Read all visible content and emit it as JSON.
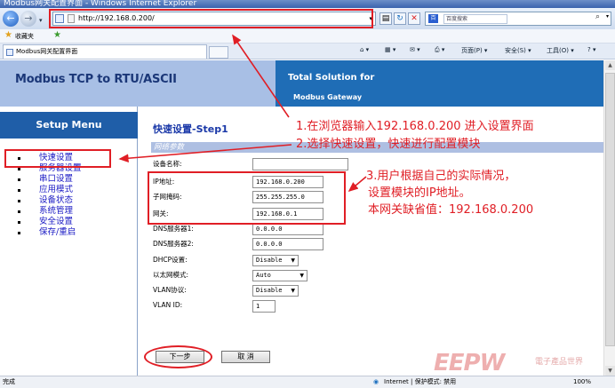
{
  "window": {
    "title": "Modbus网关配置界面 - Windows Internet Explorer"
  },
  "nav": {
    "url": "http://192.168.0.200/",
    "search_placeholder": "百度搜索",
    "search_logo": "百"
  },
  "favorites": {
    "label": "收藏夹"
  },
  "tab": {
    "title": "Modbus网关配置界面"
  },
  "commands": {
    "home": "▾",
    "feeds": "▾",
    "mail": "▾",
    "print": "▾",
    "page": "页面(P) ▾",
    "safety": "安全(S) ▾",
    "tools": "工具(O) ▾",
    "help": "▾"
  },
  "header": {
    "brand": "Modbus TCP to RTU/ASCII",
    "tagline": "Total Solution for",
    "sub": "Modbus Gateway"
  },
  "sidebar": {
    "title": "Setup Menu",
    "items": [
      "快速设置",
      "服务器设置",
      "串口设置",
      "应用模式",
      "设备状态",
      "系统管理",
      "安全设置",
      "保存/重启"
    ]
  },
  "main": {
    "step_title": "快速设置-Step1",
    "section": "网络参数",
    "fields": [
      {
        "label": "设备名称:",
        "value": ""
      },
      {
        "label": "IP地址:",
        "value": "192.168.0.200"
      },
      {
        "label": "子网掩码:",
        "value": "255.255.255.0"
      },
      {
        "label": "网关:",
        "value": "192.168.0.1"
      },
      {
        "label": "DNS服务器1:",
        "value": "0.0.0.0"
      },
      {
        "label": "DNS服务器2:",
        "value": "0.0.0.0"
      }
    ],
    "dhcp": {
      "label": "DHCP设置:",
      "value": "Disable"
    },
    "ethernet": {
      "label": "以太网模式:",
      "value": "Auto"
    },
    "vlan": {
      "label": "VLAN协议:",
      "value": "Disable"
    },
    "vlan_id": {
      "label": "VLAN ID:",
      "value": "1"
    },
    "next_button": "下一步",
    "cancel_button": "取 消"
  },
  "status": {
    "left": "完成",
    "zone": "Internet | 保护模式: 禁用",
    "zoom": "100%"
  },
  "annotations": {
    "a1": "1.在浏览器输入192.168.0.200 进入设置界面",
    "a2": "2.选择快速设置，快速进行配置模块",
    "a3_line1": "3.用户根据自己的实际情况，",
    "a3_line2": "设置模块的IP地址。",
    "a3_line3": "本网关缺省值：192.168.0.200"
  },
  "watermark": {
    "brand": "EEPW",
    "tag": "電子產品世界"
  },
  "colors": {
    "annotation_red": "#e01e25",
    "header_blue": "#1f6db6",
    "menu_blue": "#1f5ea8",
    "link_blue": "#1a1ac4",
    "section_blue": "#aebfe2"
  }
}
